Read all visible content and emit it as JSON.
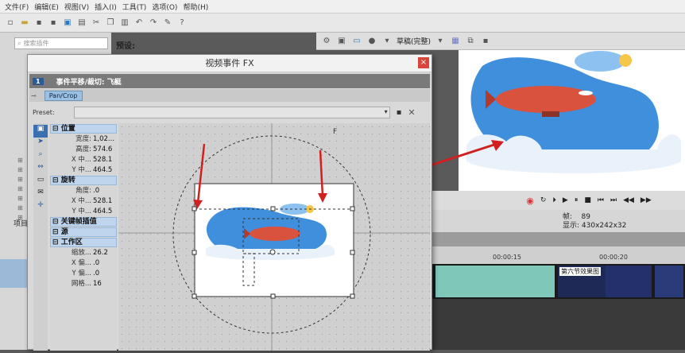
{
  "menu": [
    "文件(F)",
    "编辑(E)",
    "视图(V)",
    "插入(I)",
    "工具(T)",
    "选项(O)",
    "帮助(H)"
  ],
  "left_pane": {
    "search_placeholder": "搜索插件",
    "tab_label": "项目"
  },
  "preview_label": "预设:",
  "preview_toolbar": {
    "quality": "草稿(完整)"
  },
  "dialog": {
    "title": "视频事件 FX",
    "chain_label": "事件平移/裁切: 飞艇",
    "chain_index": "1",
    "fx_tab": "Pan/Crop",
    "preset_label": "Preset:",
    "tree": [
      {
        "section": "位置",
        "rows": [
          {
            "k": "宽度:",
            "v": "1,02..."
          },
          {
            "k": "高度:",
            "v": "574.6"
          },
          {
            "k": "X 中...",
            "v": "528.1"
          },
          {
            "k": "Y 中...",
            "v": "464.5"
          }
        ]
      },
      {
        "section": "旋转",
        "rows": [
          {
            "k": "角度:",
            "v": ".0"
          },
          {
            "k": "X 中...",
            "v": "528.1"
          },
          {
            "k": "Y 中...",
            "v": "464.5"
          }
        ]
      },
      {
        "section": "关键帧插值",
        "rows": []
      },
      {
        "section": "源",
        "rows": []
      },
      {
        "section": "工作区",
        "rows": [
          {
            "k": "缩放...",
            "v": "26.2"
          },
          {
            "k": "X 偏...",
            "v": ".0"
          },
          {
            "k": "Y 偏...",
            "v": ".0"
          },
          {
            "k": "网格...",
            "v": "16"
          }
        ]
      }
    ]
  },
  "video_info": {
    "frame_label": "帧:",
    "frame_value": "89",
    "display_label": "显示:",
    "display_value": "430x242x32"
  },
  "timeline": {
    "tc1": "00:00:15",
    "tc2": "00:00:20",
    "clip_label": "第六节效果图"
  },
  "colors": {
    "accent": "#d9453a",
    "selection": "#9bc1e2",
    "sky": "#3f8fdc",
    "airship": "#d9523e"
  }
}
